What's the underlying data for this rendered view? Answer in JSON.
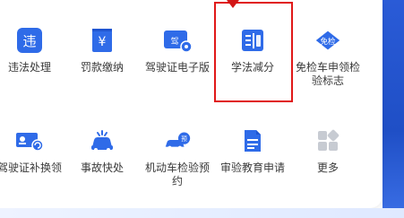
{
  "services": [
    {
      "label": "违法处理",
      "icon": "traffic-violation-icon"
    },
    {
      "label": "罚款缴纳",
      "icon": "fine-payment-icon"
    },
    {
      "label": "驾驶证电子版",
      "icon": "e-license-icon"
    },
    {
      "label": "学法减分",
      "icon": "study-law-reduce-points-icon",
      "badge": "highlighted"
    },
    {
      "label": "免检车申领检验标志",
      "icon": "inspection-exempt-icon",
      "badge_text": "免检"
    },
    {
      "label": "驾驶证补换领",
      "icon": "license-replacement-icon"
    },
    {
      "label": "事故快处",
      "icon": "accident-quick-handle-icon"
    },
    {
      "label": "机动车检验预约",
      "icon": "vehicle-inspection-appointment-icon",
      "badge_text": "预"
    },
    {
      "label": "审验教育申请",
      "icon": "review-education-icon"
    },
    {
      "label": "更多",
      "icon": "more-apps-icon"
    }
  ],
  "icon_texts": {
    "violation": "违",
    "fine": "¥",
    "license": "驾"
  },
  "colors": {
    "primary_blue": "#2f6be8",
    "highlight_red": "#e01818",
    "grey_icon": "#c7cbd2"
  }
}
